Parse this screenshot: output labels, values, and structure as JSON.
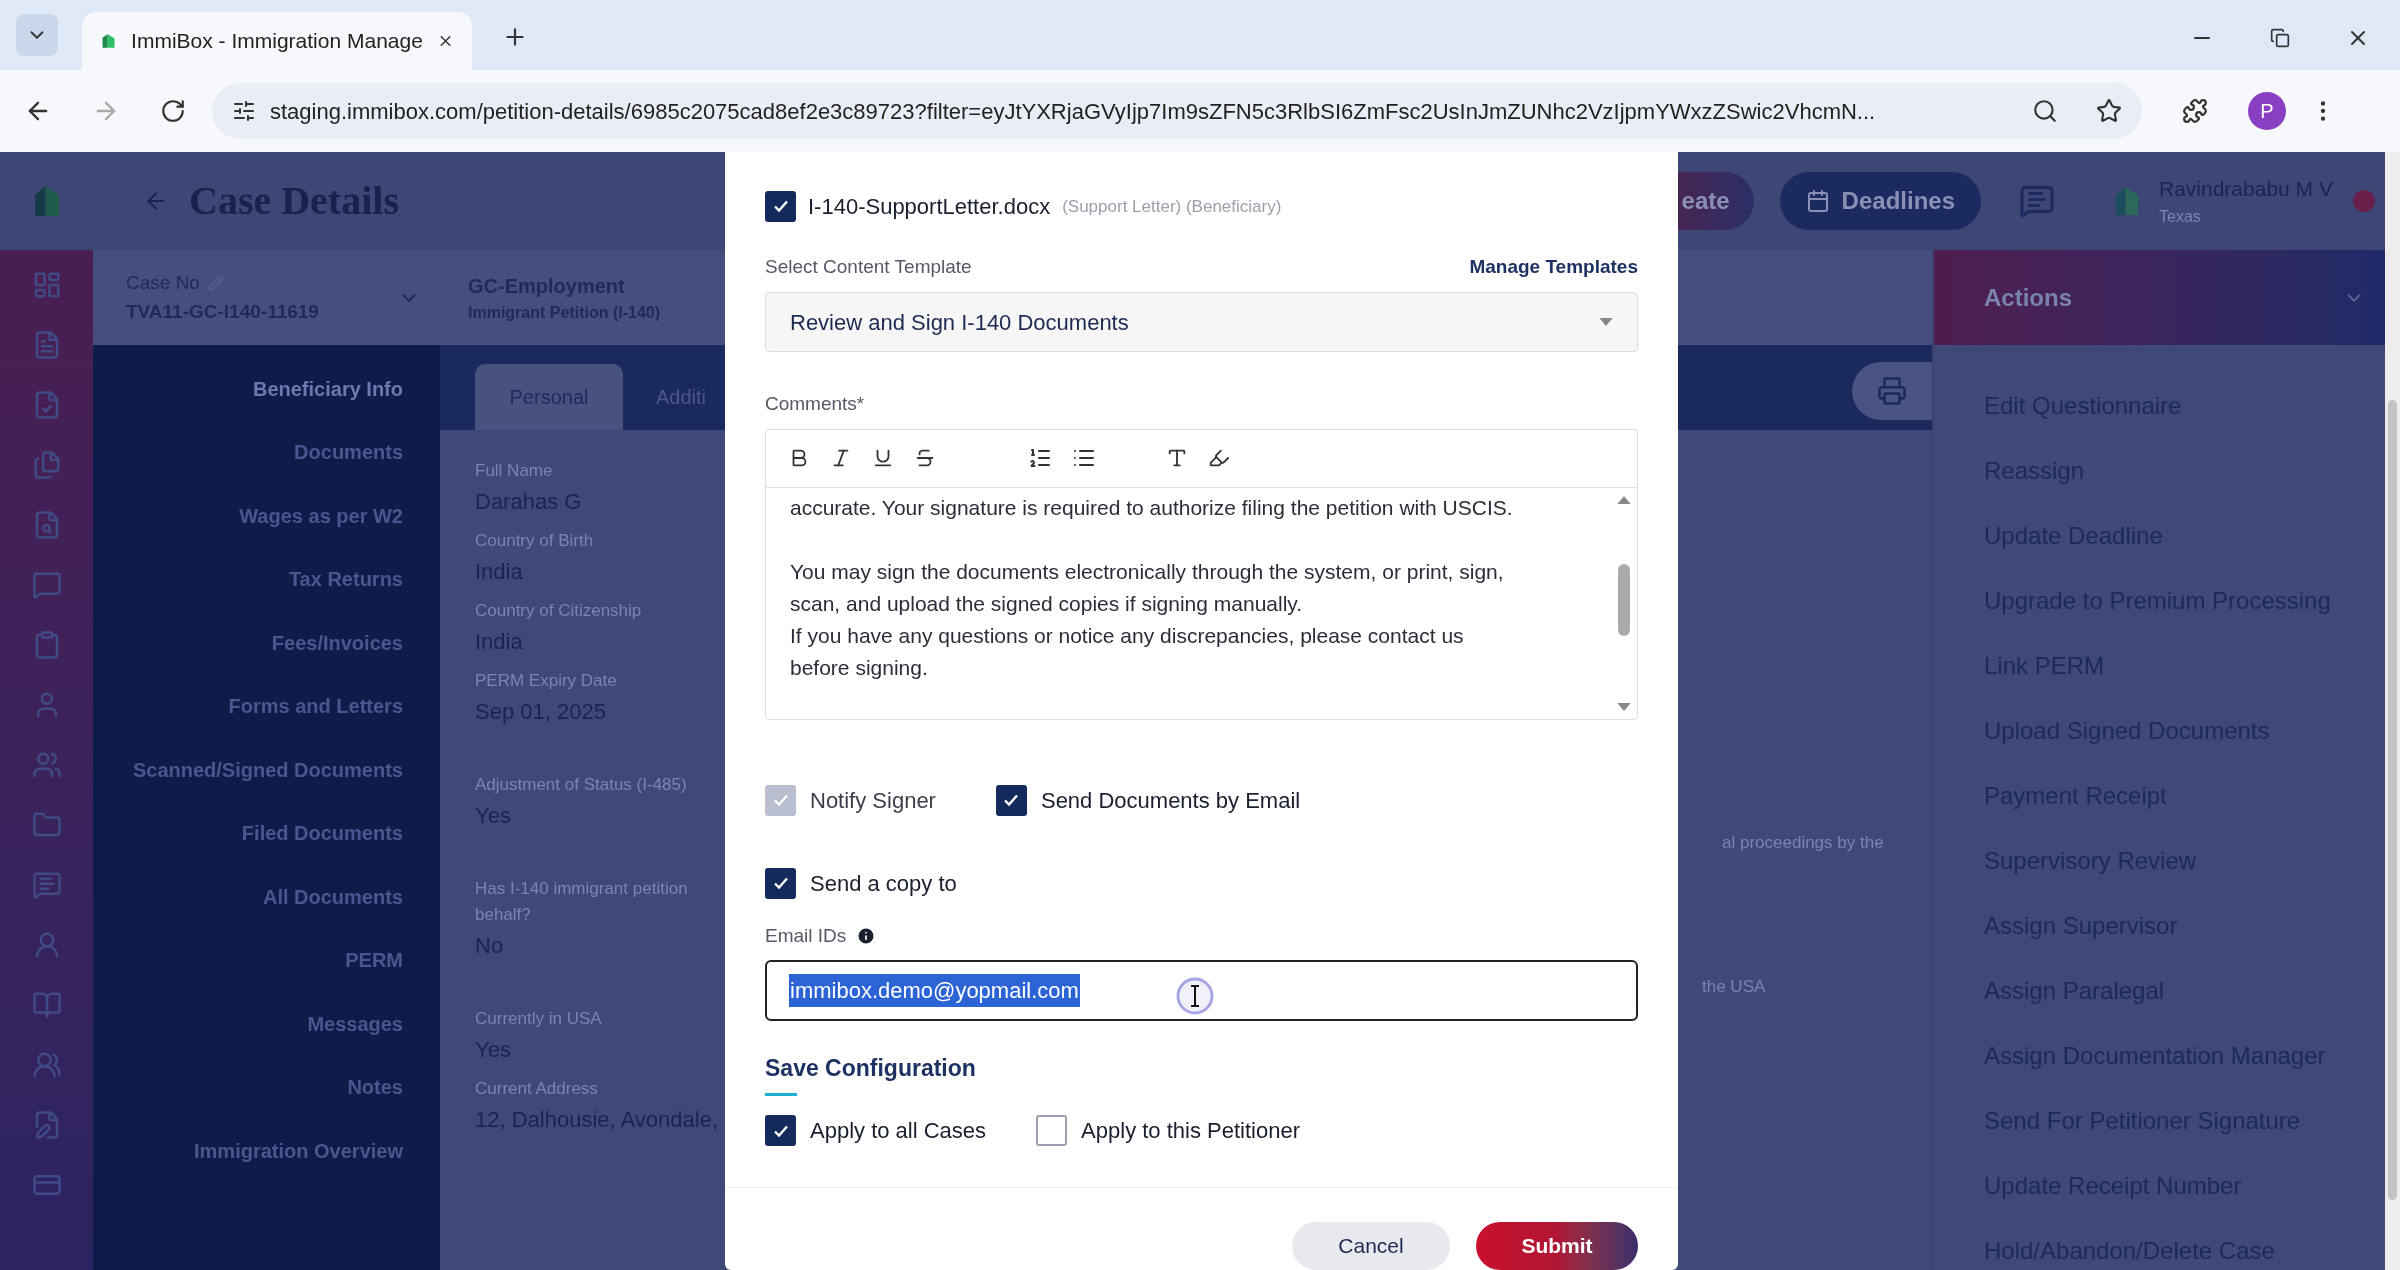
{
  "browser": {
    "tab_title": "ImmiBox - Immigration Manage",
    "url": "staging.immibox.com/petition-details/6985c2075cad8ef2e3c89723?filter=eyJtYXRjaGVyIjp7Im9sZFN5c3RlbSI6ZmFsc2UsInJmZUNhc2VzIjpmYWxzZSwic2VhcmN...",
    "profile_initial": "P"
  },
  "header": {
    "title": "Case Details",
    "partial_button": "eate",
    "deadlines_button": "Deadlines",
    "user_name": "Ravindrababu M V",
    "user_location": "Texas"
  },
  "case_bar": {
    "case_no_label": "Case No",
    "case_no": "TVA11-GC-I140-11619",
    "case_type": "GC-Employment",
    "case_subtype": "Immigrant Petition (I-140)"
  },
  "side_nav": [
    {
      "label": "Beneficiary Info",
      "selected": true
    },
    {
      "label": "Documents",
      "selected": false
    },
    {
      "label": "Wages as per W2",
      "selected": false
    },
    {
      "label": "Tax Returns",
      "selected": false
    },
    {
      "label": "Fees/Invoices",
      "selected": false
    },
    {
      "label": "Forms and Letters",
      "selected": false
    },
    {
      "label": "Scanned/Signed Documents",
      "selected": false
    },
    {
      "label": "Filed Documents",
      "selected": false
    },
    {
      "label": "All Documents",
      "selected": false
    },
    {
      "label": "PERM",
      "selected": false
    },
    {
      "label": "Messages",
      "selected": false
    },
    {
      "label": "Notes",
      "selected": false
    },
    {
      "label": "Immigration Overview",
      "selected": false
    }
  ],
  "tabs": [
    {
      "label": "Personal",
      "selected": true
    },
    {
      "label": "Additi",
      "selected": false
    }
  ],
  "fields": [
    {
      "label": "Full Name",
      "value": "Darahas G"
    },
    {
      "label": "Country of Birth",
      "value": "India"
    },
    {
      "label": "Country of Citizenship",
      "value": "India"
    },
    {
      "label": "PERM Expiry Date",
      "value": "Sep 01, 2025"
    },
    {
      "label": "Adjustment of Status (I-485)",
      "value": "Yes"
    },
    {
      "label": "Has I-140 immigrant petition\nbehalf?",
      "value": "No"
    },
    {
      "label": "Currently in USA",
      "value": "Yes"
    },
    {
      "label": "Current Address",
      "value": "12, Dalhousie, Avondale,"
    }
  ],
  "right_fragments": [
    "al proceedings by the",
    "the USA"
  ],
  "actions": {
    "title": "Actions",
    "items": [
      "Edit Questionnaire",
      "Reassign",
      "Update Deadline",
      "Upgrade to Premium Processing",
      "Link PERM",
      "Upload Signed Documents",
      "Payment Receipt",
      "Supervisory Review",
      "Assign Supervisor",
      "Assign Paralegal",
      "Assign Documentation Manager",
      "Send For Petitioner Signature",
      "Update Receipt Number",
      "Hold/Abandon/Delete Case"
    ]
  },
  "modal": {
    "documents": [
      {
        "name": "I-140-SupportLetter.docx",
        "tags": "(Support Letter) (Beneficiary)",
        "checked": true
      }
    ],
    "template_label": "Select Content Template",
    "manage_link": "Manage Templates",
    "template_value": "Review and Sign I-140 Documents",
    "comments_label": "Comments*",
    "comment_blocks": [
      [
        "accurate. Your signature is required to authorize filing the petition with USCIS."
      ],
      [
        "You may sign the documents electronically through the system, or print, sign, scan, and upload the signed copies if signing manually.",
        "If you have any questions or notice any discrepancies, please contact us before signing."
      ]
    ],
    "options": [
      {
        "label": "Notify Signer",
        "checked": true,
        "disabled": true
      },
      {
        "label": "Send Documents by Email",
        "checked": true,
        "disabled": false
      }
    ],
    "copy": {
      "label": "Send a copy to",
      "checked": true
    },
    "email_label": "Email IDs",
    "email_value": "immibox.demo@yopmail.com",
    "config_title": "Save Configuration",
    "config_options": [
      {
        "label": "Apply to all Cases",
        "checked": true
      },
      {
        "label": "Apply to this Petitioner",
        "checked": false
      }
    ],
    "cancel": "Cancel",
    "submit": "Submit"
  }
}
